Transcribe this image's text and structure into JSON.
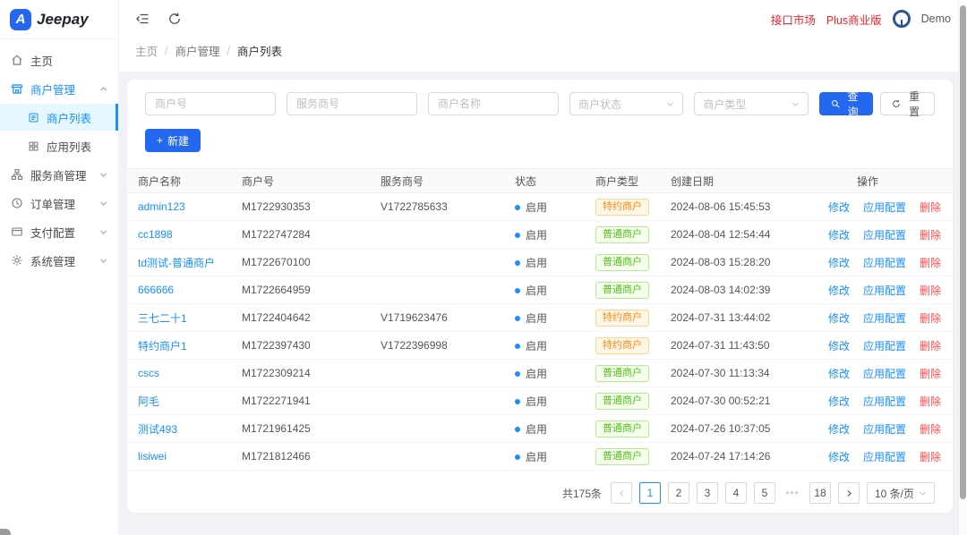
{
  "brand": {
    "name": "Jeepay",
    "logo_letter": "A"
  },
  "colors": {
    "primary": "#2468f2",
    "link_blue": "#1890ff",
    "danger_red": "#ff4d4f",
    "header_red": "#f5222d",
    "tag_orange": "#fa8c16",
    "tag_green": "#52c41a",
    "active_menu_bg": "#e6f7ff",
    "page_bg": "#f0f2f5"
  },
  "header": {
    "links": [
      {
        "label": "接口市场"
      },
      {
        "label": "Plus商业版"
      }
    ],
    "user": "Demo"
  },
  "breadcrumb": [
    "主页",
    "商户管理",
    "商户列表"
  ],
  "breadcrumb_separator": "/",
  "sidebar": {
    "items": [
      {
        "label": "主页",
        "icon": "home-icon"
      },
      {
        "label": "商户管理",
        "icon": "shop-icon",
        "expanded": true,
        "active": true,
        "children": [
          {
            "label": "商户列表",
            "icon": "list-icon",
            "active": true
          },
          {
            "label": "应用列表",
            "icon": "appstore-icon"
          }
        ]
      },
      {
        "label": "服务商管理",
        "icon": "cluster-icon"
      },
      {
        "label": "订单管理",
        "icon": "order-icon"
      },
      {
        "label": "支付配置",
        "icon": "pay-config-icon"
      },
      {
        "label": "系统管理",
        "icon": "settings-icon"
      }
    ]
  },
  "filters": {
    "inputs": [
      {
        "placeholder": "商户号",
        "value": ""
      },
      {
        "placeholder": "服务商号",
        "value": ""
      },
      {
        "placeholder": "商户名称",
        "value": ""
      }
    ],
    "selects": [
      {
        "placeholder": "商户状态"
      },
      {
        "placeholder": "商户类型"
      }
    ],
    "search_label": "查询",
    "reset_label": "重置",
    "new_label": "新建",
    "new_plus": "+"
  },
  "table": {
    "columns": [
      "商户名称",
      "商户号",
      "服务商号",
      "状态",
      "商户类型",
      "创建日期",
      "操作"
    ],
    "actions": [
      "修改",
      "应用配置",
      "删除"
    ],
    "rows": [
      {
        "name": "admin123",
        "mch_no": "M1722930353",
        "isv_no": "V1722785633",
        "state": "启用",
        "type": "特约商户",
        "type_style": "orange",
        "created": "2024-08-06 15:45:53"
      },
      {
        "name": "cc1898",
        "mch_no": "M1722747284",
        "isv_no": "",
        "state": "启用",
        "type": "普通商户",
        "type_style": "green",
        "created": "2024-08-04 12:54:44"
      },
      {
        "name": "td测试-普通商户",
        "mch_no": "M1722670100",
        "isv_no": "",
        "state": "启用",
        "type": "普通商户",
        "type_style": "green",
        "created": "2024-08-03 15:28:20"
      },
      {
        "name": "666666",
        "mch_no": "M1722664959",
        "isv_no": "",
        "state": "启用",
        "type": "普通商户",
        "type_style": "green",
        "created": "2024-08-03 14:02:39"
      },
      {
        "name": "三七二十1",
        "mch_no": "M1722404642",
        "isv_no": "V1719623476",
        "state": "启用",
        "type": "特约商户",
        "type_style": "orange",
        "created": "2024-07-31 13:44:02"
      },
      {
        "name": "特约商户1",
        "mch_no": "M1722397430",
        "isv_no": "V1722396998",
        "state": "启用",
        "type": "特约商户",
        "type_style": "orange",
        "created": "2024-07-31 11:43:50"
      },
      {
        "name": "cscs",
        "mch_no": "M1722309214",
        "isv_no": "",
        "state": "启用",
        "type": "普通商户",
        "type_style": "green",
        "created": "2024-07-30 11:13:34"
      },
      {
        "name": "阿毛",
        "mch_no": "M1722271941",
        "isv_no": "",
        "state": "启用",
        "type": "普通商户",
        "type_style": "green",
        "created": "2024-07-30 00:52:21"
      },
      {
        "name": "测试493",
        "mch_no": "M1721961425",
        "isv_no": "",
        "state": "启用",
        "type": "普通商户",
        "type_style": "green",
        "created": "2024-07-26 10:37:05"
      },
      {
        "name": "lisiwei",
        "mch_no": "M1721812466",
        "isv_no": "",
        "state": "启用",
        "type": "普通商户",
        "type_style": "green",
        "created": "2024-07-24 17:14:26"
      }
    ]
  },
  "pagination": {
    "total_label": "共175条",
    "pages": [
      "1",
      "2",
      "3",
      "4",
      "5"
    ],
    "active_page": "1",
    "ellipsis": "•••",
    "last_page": "18",
    "page_size_label": "10 条/页"
  }
}
